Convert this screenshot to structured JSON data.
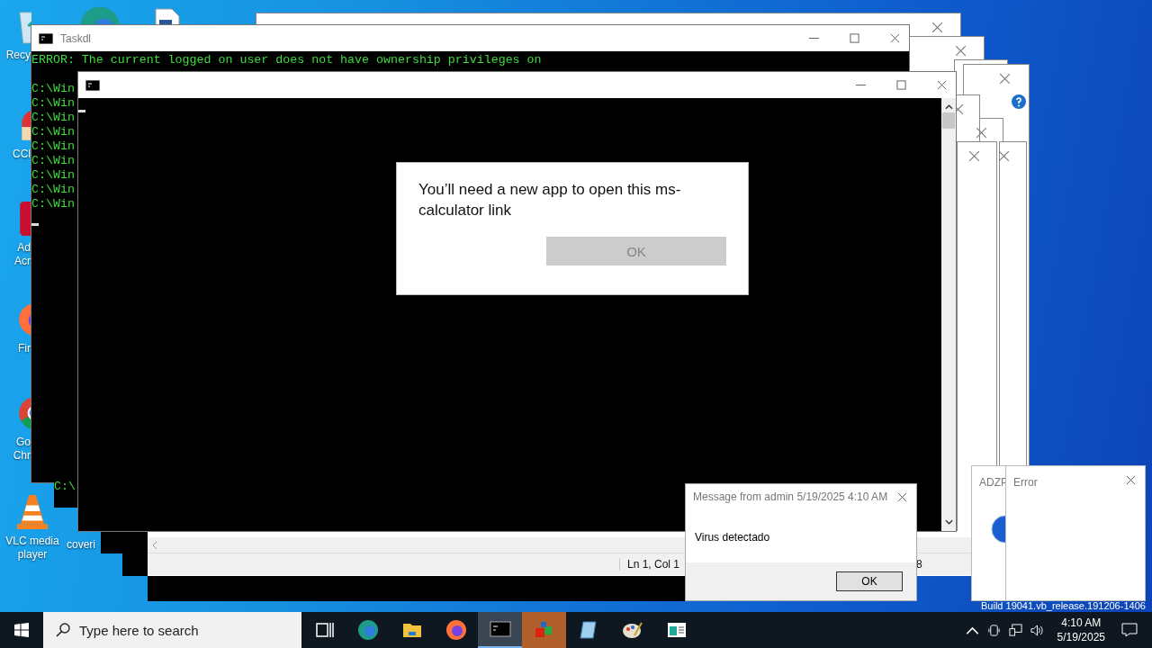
{
  "desktop_icons": [
    {
      "kind": "recycle-bin",
      "lines": [
        "Recy"
      ]
    },
    {
      "kind": "edge"
    },
    {
      "kind": "document"
    },
    {
      "kind": "ccleaner",
      "lines": [
        "CCl"
      ]
    },
    {
      "kind": "acrobat",
      "lines": [
        "Ad",
        "Acr"
      ]
    },
    {
      "kind": "firefox",
      "lines": [
        "Fir"
      ]
    },
    {
      "kind": "chrome",
      "lines": [
        "Go",
        "Chr"
      ]
    },
    {
      "kind": "vlc",
      "lines": [
        "VLC media",
        "player"
      ]
    },
    {
      "lines": [
        "coveri"
      ]
    }
  ],
  "taskdl": {
    "title": "Taskdl",
    "lines": [
      "ERROR: The current logged on user does not have ownership privileges on",
      "C:\\Win",
      "C:\\Win",
      "C:\\Win",
      "C:\\Win",
      "C:\\Win",
      "C:\\Win",
      "C:\\Win",
      "C:\\Win",
      "C:\\Win"
    ]
  },
  "stray_console": {
    "text": "C:\\"
  },
  "app_dialog": {
    "message": "You’ll need a new app to open this ms-calculator link",
    "button": {
      "label": "OK",
      "disabled": true
    }
  },
  "editor_status": {
    "position": "Ln 1, Col 1",
    "column_2": "8"
  },
  "message_box": {
    "title": "Message from admin 5/19/2025 4:10 AM",
    "text": "Virus detectado",
    "button": "OK"
  },
  "adzp_window": {
    "title": "ADZP"
  },
  "error_window": {
    "title": "Error"
  },
  "build_text": "Build 19041.vb_release.191206-1406",
  "taskbar": {
    "search_placeholder": "Type here to search",
    "apps": [
      {
        "kind": "task-view",
        "selected": false,
        "attention": false
      },
      {
        "kind": "edge",
        "selected": false,
        "attention": false
      },
      {
        "kind": "folder",
        "selected": false,
        "attention": false
      },
      {
        "kind": "firefox",
        "selected": false,
        "attention": false
      },
      {
        "kind": "console",
        "selected": true,
        "attention": false
      },
      {
        "kind": "cubes",
        "selected": false,
        "attention": true
      },
      {
        "kind": "notepad",
        "selected": false,
        "attention": false
      },
      {
        "kind": "paint",
        "selected": false,
        "attention": false
      },
      {
        "kind": "app-window",
        "selected": false,
        "attention": false
      }
    ],
    "time": "4:10 AM",
    "date": "5/19/2025"
  }
}
